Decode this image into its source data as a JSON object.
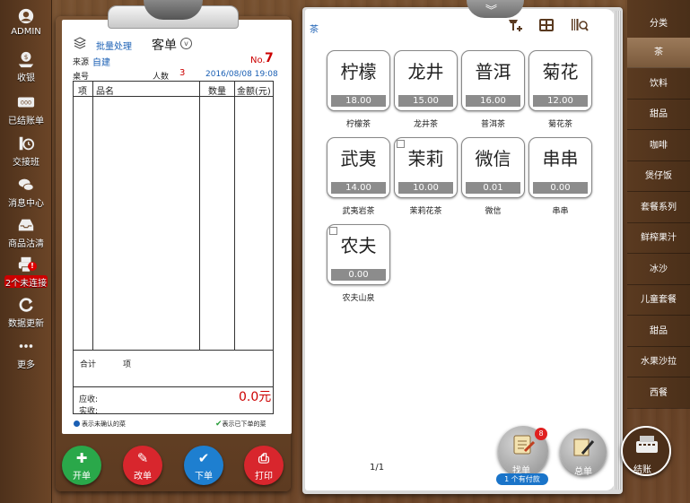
{
  "sidebar": {
    "items": [
      {
        "label": "ADMIN",
        "icon": "user-avatar-icon"
      },
      {
        "label": "收银",
        "icon": "cashier-icon"
      },
      {
        "label": "已结账单",
        "icon": "settled-bills-icon"
      },
      {
        "label": "交接班",
        "icon": "shift-handover-icon"
      },
      {
        "label": "消息中心",
        "icon": "message-icon"
      },
      {
        "label": "商品沽清",
        "icon": "soldout-icon"
      },
      {
        "label": "2个未连接",
        "icon": "printer-icon"
      },
      {
        "label": "数据更新",
        "icon": "refresh-icon"
      },
      {
        "label": "更多",
        "icon": "more-icon"
      }
    ],
    "alert_badge": "!"
  },
  "order": {
    "batch_label": "批量处理",
    "title": "客单",
    "source_label": "来源",
    "source_value": "自建",
    "no_label": "No.",
    "no_value": "7",
    "table_label": "桌号",
    "people_label": "人数",
    "people_value": "3",
    "datetime": "2016/08/08 19:08",
    "columns": [
      "项",
      "品名",
      "数量",
      "金额(元)"
    ],
    "total_label": "合计",
    "total_unit": "项",
    "receivable_label": "应收:",
    "receivable_value": "0.0元",
    "paid_label": "实收:",
    "legend_unconfirmed": "表示未确认的菜",
    "legend_ordered": "表示已下单的菜"
  },
  "actions": [
    {
      "label": "开单",
      "icon": "plus-icon",
      "color": "#2aa84a"
    },
    {
      "label": "改单",
      "icon": "pencil-icon",
      "color": "#d8262d"
    },
    {
      "label": "下单",
      "icon": "check-icon",
      "color": "#1e7fd0"
    },
    {
      "label": "打印",
      "icon": "printer-icon",
      "color": "#d8262d"
    }
  ],
  "menu": {
    "current_category": "茶",
    "dishes": [
      {
        "name": "柠檬",
        "price": "18.00",
        "caption": "柠檬茶"
      },
      {
        "name": "龙井",
        "price": "15.00",
        "caption": "龙井茶"
      },
      {
        "name": "普洱",
        "price": "16.00",
        "caption": "普洱茶"
      },
      {
        "name": "菊花",
        "price": "12.00",
        "caption": "菊花茶"
      },
      {
        "name": "武夷",
        "price": "14.00",
        "caption": "武夷岩茶"
      },
      {
        "name": "茉莉",
        "price": "10.00",
        "caption": "茉莉花茶"
      },
      {
        "name": "微信",
        "price": "0.01",
        "caption": "微信"
      },
      {
        "name": "串串",
        "price": "0.00",
        "caption": "串串"
      },
      {
        "name": "农夫",
        "price": "0.00",
        "caption": "农夫山泉"
      }
    ],
    "pager": "1/1"
  },
  "bottom": {
    "find_label": "找单",
    "find_badge": "8",
    "pay_pill": "1 个有付款",
    "cook_label": "总单",
    "checkout_label": "结账"
  },
  "categories": {
    "header": "分类",
    "items": [
      "茶",
      "饮料",
      "甜品",
      "咖啡",
      "煲仔饭",
      "套餐系列",
      "鲜榨果汁",
      "冰沙",
      "儿童套餐",
      "甜品",
      "水果沙拉",
      "西餐"
    ],
    "active": "茶"
  }
}
